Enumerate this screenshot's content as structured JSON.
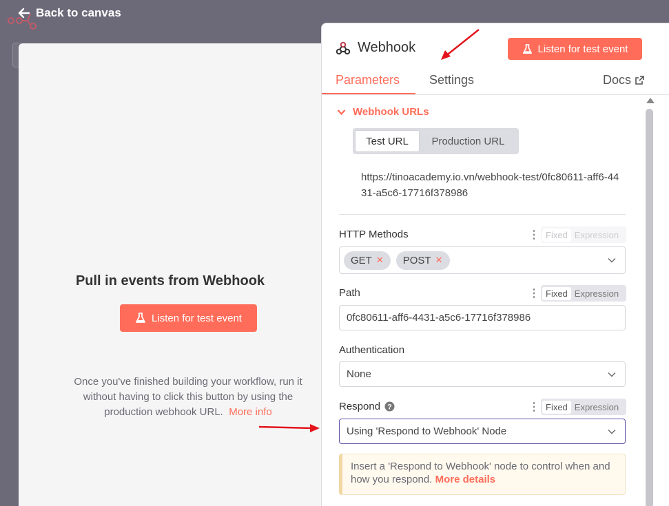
{
  "nav": {
    "back_label": "Back to canvas"
  },
  "left": {
    "title": "Pull in events from Webhook",
    "button_label": "Listen for test event",
    "description": "Once you've finished building your workflow, run it without having to click this button by using the production webhook URL.",
    "more_info": "More info"
  },
  "node": {
    "title": "Webhook",
    "listen_button": "Listen for test event",
    "tabs": {
      "parameters": "Parameters",
      "settings": "Settings",
      "docs": "Docs"
    },
    "webhook_urls": {
      "title": "Webhook URLs",
      "toggle": {
        "test": "Test URL",
        "production": "Production URL"
      },
      "url": "https://tinoacademy.io.vn/webhook-test/0fc80611-aff6-4431-a5c6-17716f378986"
    },
    "http_methods": {
      "label": "HTTP Methods",
      "chips": [
        "GET",
        "POST"
      ]
    },
    "path": {
      "label": "Path",
      "value": "0fc80611-aff6-4431-a5c6-17716f378986"
    },
    "authentication": {
      "label": "Authentication",
      "value": "None"
    },
    "respond": {
      "label": "Respond",
      "value": "Using 'Respond to Webhook' Node"
    },
    "fixed_label": "Fixed",
    "expression_label": "Expression",
    "notice": {
      "text": "Insert a 'Respond to Webhook' node to control when and how you respond.",
      "link": "More details"
    }
  },
  "colors": {
    "accent": "#ff6d5a",
    "annotation_arrow": "#e3141c"
  }
}
